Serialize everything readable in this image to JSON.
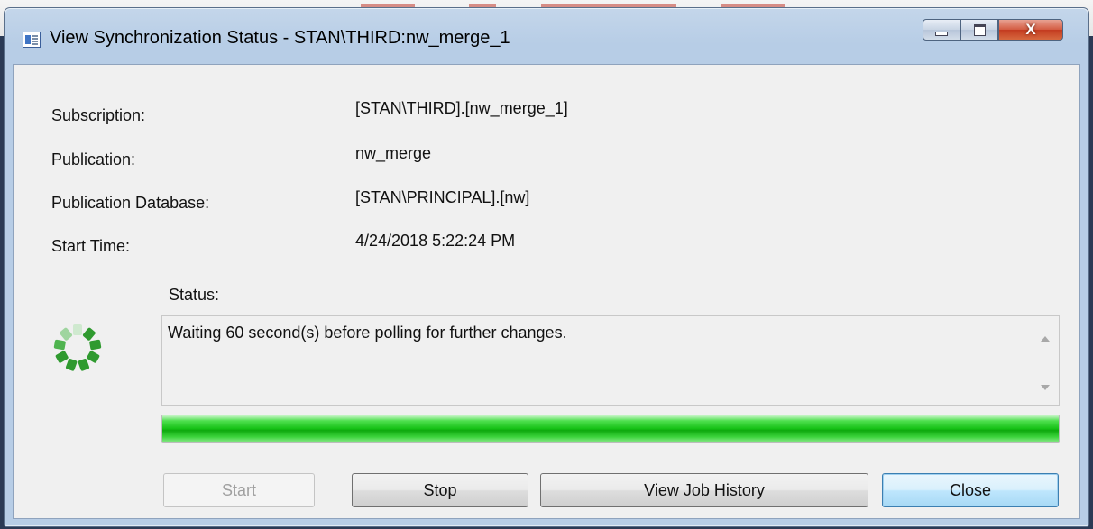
{
  "window": {
    "title": "View Synchronization Status - STAN\\THIRD:nw_merge_1",
    "controls": {
      "close_glyph": "X"
    }
  },
  "details": [
    {
      "label": "Subscription:",
      "value": "[STAN\\THIRD].[nw_merge_1]"
    },
    {
      "label": "Publication:",
      "value": "nw_merge"
    },
    {
      "label": "Publication Database:",
      "value": "[STAN\\PRINCIPAL].[nw]"
    },
    {
      "label": "Start Time:",
      "value": "4/24/2018 5:22:24 PM"
    }
  ],
  "status": {
    "label": "Status:",
    "message": "Waiting 60 second(s) before polling for further changes.",
    "progress": 1.0
  },
  "buttons": {
    "start": "Start",
    "stop": "Stop",
    "view_job_history": "View Job History",
    "close": "Close"
  },
  "colors": {
    "progress_green": "#14c014",
    "spinner_green": "#2f9a2f"
  }
}
